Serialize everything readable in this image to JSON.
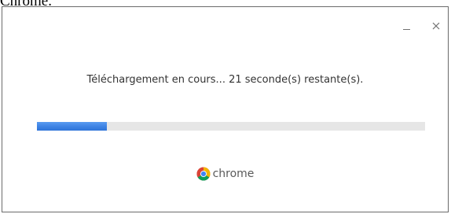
{
  "caption": "Chrome.",
  "window": {
    "status_text": "Téléchargement en cours... 21 seconde(s) restante(s).",
    "progress": 0.18,
    "accent": "#3c82e4",
    "brand_name": "chrome",
    "controls": {
      "minimize_icon": "minimize-icon",
      "close_icon": "close-icon",
      "close_glyph": "✕"
    }
  }
}
